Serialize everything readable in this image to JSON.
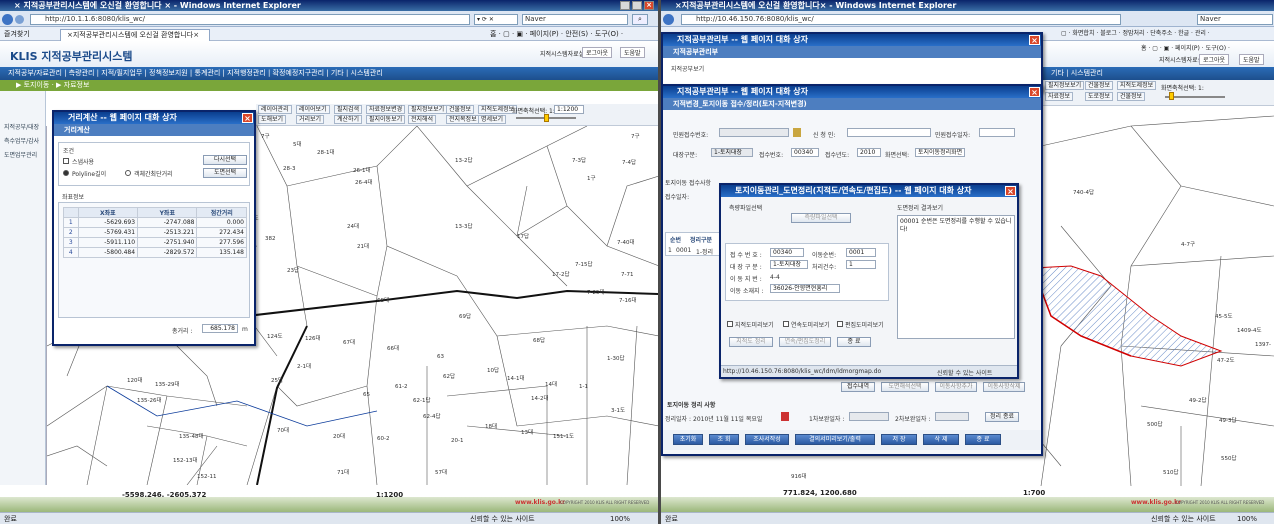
{
  "left": {
    "window_title": "× 지적공부관리시스템에 오신걸 환영합니다 × - Windows Internet Explorer",
    "address": "http://10.1.1.6:8080/klis_wc/",
    "search_placeholder": "Naver",
    "favorites_label": "즐겨찾기",
    "tab_title": "×지적공부관리시스템에 오신걸 환영합니다×",
    "ie_menu": "홈 · ▢ · ▣ · 페이지(P) · 안전(S) · 도구(O) ·",
    "logo": "KLIS 지적공부관리시스템",
    "header_links": [
      "지적시스템자료실",
      "로그아웃",
      "도움말"
    ],
    "menu": "지적공부/자료관리 | 측량관리 | 지적/필지업무 | 정책정보지원 | 통계관리 | 지적행정관리 | 확정예정지구관리 | 기타 | 시스템관리",
    "breadcrumb": "▶ 토지이동 · ▶ 자료정보",
    "side_items": [
      "지적공부/대장",
      "측수업무/감사",
      "도면업무관리"
    ],
    "toolbar": [
      "레이어관리",
      "레이어보기",
      "필지검색",
      "자료정보변경",
      "필지정보보기",
      "건물정보",
      "지적도제정보"
    ],
    "toolbar2": [
      "도해보기",
      "거리보기",
      "계산하기",
      "필지이동보기",
      "전지해석",
      "전지목정보",
      "명세보기"
    ],
    "scale_label": "화면축척선택: 1:",
    "scale_value": "1:1200",
    "map_labels": [
      "7구",
      "9대",
      "5대",
      "13-2답",
      "7-3답",
      "7-4답",
      "26-1대",
      "26-4대",
      "28-1대",
      "28-3",
      "1구",
      "165도",
      "382",
      "24대",
      "21대",
      "23답",
      "13-3답",
      "17답",
      "7-40대",
      "7-15답",
      "17-2답",
      "7-71",
      "7-25대",
      "7-16대",
      "68대",
      "67대",
      "66대",
      "69답",
      "68답",
      "63",
      "62답",
      "10답",
      "14-1대",
      "14대",
      "14-2대",
      "1-1",
      "1-30답",
      "3-1도",
      "120대",
      "135-29대",
      "25답",
      "61-2",
      "62-1답",
      "62-4답",
      "60-2",
      "20대",
      "20-1",
      "18대",
      "13대",
      "71대",
      "57대",
      "135-26대",
      "135-48대",
      "151-1도",
      "152-13대",
      "152-11",
      "361",
      "124도",
      "126대",
      "2-1대",
      "65",
      "70대",
      "7구"
    ],
    "bottom_coords": "-5598.246, -2605.372",
    "bottom_scale": "1:1200",
    "site_url": "www.klis.go.kr",
    "copyright": "COPYRIGHT 2010 KLIS ALL RIGHT RESERVED",
    "status_left": "완료",
    "status_trusted": "신뢰할 수 있는 사이트",
    "status_zoom": "100%",
    "dialog": {
      "title": "거리계산 -- 웹 페이지 대화 상자",
      "section1": "거리계산",
      "cond_label": "조건",
      "opt1": "스냅사용",
      "radio1": "Polyline길이",
      "radio2": "객체간최단거리",
      "btn_reselect": "다시선택",
      "btn_select": "도면선택",
      "coord_label": "좌표정보",
      "headers": [
        "",
        "X좌표",
        "Y좌표",
        "점간거리"
      ],
      "rows": [
        [
          "1",
          "-5629.693",
          "-2747.088",
          "0.000"
        ],
        [
          "2",
          "-5769.431",
          "-2513.221",
          "272.434"
        ],
        [
          "3",
          "-5911.110",
          "-2751.940",
          "277.596"
        ],
        [
          "4",
          "-5800.484",
          "-2829.572",
          "135.148"
        ]
      ],
      "total_label": "총거리 :",
      "total_value": "685.178",
      "total_unit": "m"
    }
  },
  "right": {
    "window_title": "×지적공부관리시스템에 오신걸 환영합니다× - Windows Internet Explorer",
    "address": "http://10.46.150.76:8080/klis_wc/",
    "search_placeholder": "Naver",
    "ie_menu": "▢ · 화면합치 · 블로그 · 정맘처리 · 단축주소 · 한글 · 관리 ·",
    "ie_menu2": "홈 · ▢ · ▣ · 페이지(P) · 도구(O) ·",
    "header_links": [
      "지적시스템자료실",
      "로그아웃",
      "도움말"
    ],
    "menu_frag": "기타 | 시스템관리",
    "scale_label": "화면축척선택: 1:",
    "toolbar": [
      "필지정보보기",
      "건물정보",
      "지적도제정보",
      "자료정보",
      "도로정보",
      "건물정보"
    ],
    "map_labels": [
      "740-4답",
      "4-7구",
      "45-5도",
      "1409-4도",
      "1397-",
      "47-2도",
      "49-2답",
      "49-3답",
      "500답",
      "510답",
      "550답",
      "916대"
    ],
    "bottom_coords": "771.824, 1200.680",
    "bottom_scale": "1:700",
    "site_url": "www.klis.go.kr",
    "copyright": "COPYRIGHT 2010 KLIS ALL RIGHT RESERVED",
    "status_left": "완료",
    "status_trusted": "신뢰할 수 있는 사이트",
    "status_zoom": "100%",
    "dlg_back": {
      "title": "지적공부관리부 -- 웹 페이지 대화 상자",
      "section": "지적공부관리부",
      "row": "지적공부보기"
    },
    "dlg_main": {
      "title": "지적공부관리부 -- 웹 페이지 대화 상자",
      "section": "지적변경_토지이동 접수/정리(토지-지적변경)",
      "f_apply_no": "민원접수번호:",
      "f_applicant": "신 청 인:",
      "f_apply_date": "민원접수일자:",
      "f_ledger": "대장구분:",
      "v_ledger": "1-토지대장",
      "f_recv_no": "접수번호:",
      "v_recv_no": "00340",
      "f_year": "접수년도:",
      "v_year": "2010",
      "f_screen": "화면선택:",
      "v_screen": "토지이동정리화면",
      "list_label": "토지이동 접수사항",
      "recv_label": "접수일자:",
      "grid_headers": [
        "순번",
        "정리구분"
      ],
      "grid_row": [
        "1",
        "0001",
        "1-정리"
      ],
      "btn_recv_detail": "접수내역",
      "btn_map_select": "도면해석선택",
      "btn_move_add": "이동사항추가",
      "btn_move_del": "이동사항삭제",
      "summary_label": "토지이동 정리 사항",
      "arrange_date_label": "정리일자 :",
      "arrange_date_value": "2010년 11월 11일 목요일",
      "prev_label1": "1차보완일자 :",
      "prev_label2": "2차보완일자 :",
      "btn_cancel_arrange": "정리 종료",
      "bottom_buttons": [
        "초기화",
        "조 회",
        "조사서작성",
        "결의서미리보기/출력",
        "저 장",
        "삭 제",
        "종 료"
      ]
    },
    "dlg_inner": {
      "title": "토지이동관리_도면정리(지적도/연속도/편집도) -- 웹 페이지 대화 상자",
      "survey_label": "측량파일선택",
      "survey_btn": "측량파일선택",
      "result_label": "도면정리 결과보기",
      "result_text": "00001 순번은 도면정리를 수행할 수 있습니다!",
      "f_recv": "접 수 번 호 :",
      "v_recv": "00340",
      "f_mod": "이동순번:",
      "v_mod": "0001",
      "f_ledger": "대 장 구 분 :",
      "v_ledger": "1-토지대장",
      "f_count": "처리건수:",
      "v_count": "1",
      "f_num": "이 동 지 번 :",
      "v_num": "4-4",
      "f_addr": "이동 소재지 :",
      "v_addr": "36026-안향면현흥리",
      "chk1": "지적도미리보기",
      "chk2": "연속도미리보기",
      "chk3": "편집도미리보기",
      "btn1": "지적도 정리",
      "btn2": "연속/편집도정리",
      "btn3": "종 료",
      "status_url": "http://10.46.150.76:8080/klis_wc/ldm/ldmorgmap.do",
      "status_trusted": "신뢰할 수 있는 사이트"
    }
  },
  "colors": {
    "title_bar": "#0a246a",
    "menu": "#2b6cb7",
    "accent_green": "#7aa63a",
    "hatch": "#d00000"
  }
}
